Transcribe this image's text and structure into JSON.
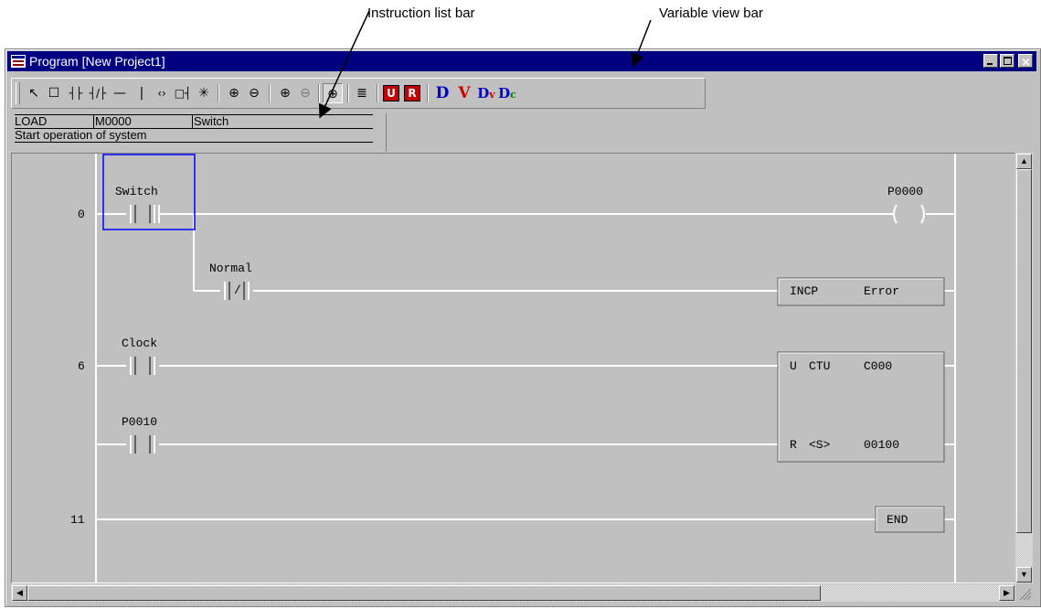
{
  "callouts": {
    "instruction_list_bar": "Instruction list bar",
    "variable_view_bar": "Variable view bar"
  },
  "window": {
    "title": "Program [New Project1]",
    "controls": [
      "minimize",
      "maximize",
      "close"
    ]
  },
  "toolbar": {
    "tools": [
      "pointer-icon",
      "box-icon",
      "contact-no-icon",
      "contact-nc-icon",
      "horizontal-line-icon",
      "vertical-line-icon",
      "coil-icon",
      "function-icon",
      "cross-icon"
    ],
    "zoom": [
      "zoom-in-icon",
      "zoom-out-icon",
      "zoom-in-alt-icon",
      "zoom-out-alt-icon",
      "zoom-fit-icon"
    ],
    "view": [
      "instruction-list-icon",
      "u-icon",
      "r-icon"
    ],
    "variable_view": {
      "d": "D",
      "v": "V",
      "dv": "Dv",
      "dc": "Dc"
    },
    "colors": {
      "u_box": "#c00000",
      "d": "#0000cc",
      "v": "#cc0000",
      "dv_d": "#0000cc",
      "dv_v": "#cc0000",
      "dc_d": "#0000cc",
      "dc_c": "#008000"
    }
  },
  "instruction_list": {
    "op": "LOAD",
    "device": "M0000",
    "variable": "Switch",
    "comment": "Start operation of system"
  },
  "ladder": {
    "step_numbers": [
      "0",
      "6",
      "11"
    ],
    "contacts": [
      "Switch",
      "Normal",
      "Clock",
      "P0010"
    ],
    "coil": "P0000",
    "incp": {
      "op": "INCP",
      "operand": "Error"
    },
    "ctu": {
      "u": "U",
      "op": "CTU",
      "counter": "C000",
      "r": "R",
      "s": "<S>",
      "preset": "00100"
    },
    "end": "END",
    "selection_color": "#0000ff"
  }
}
